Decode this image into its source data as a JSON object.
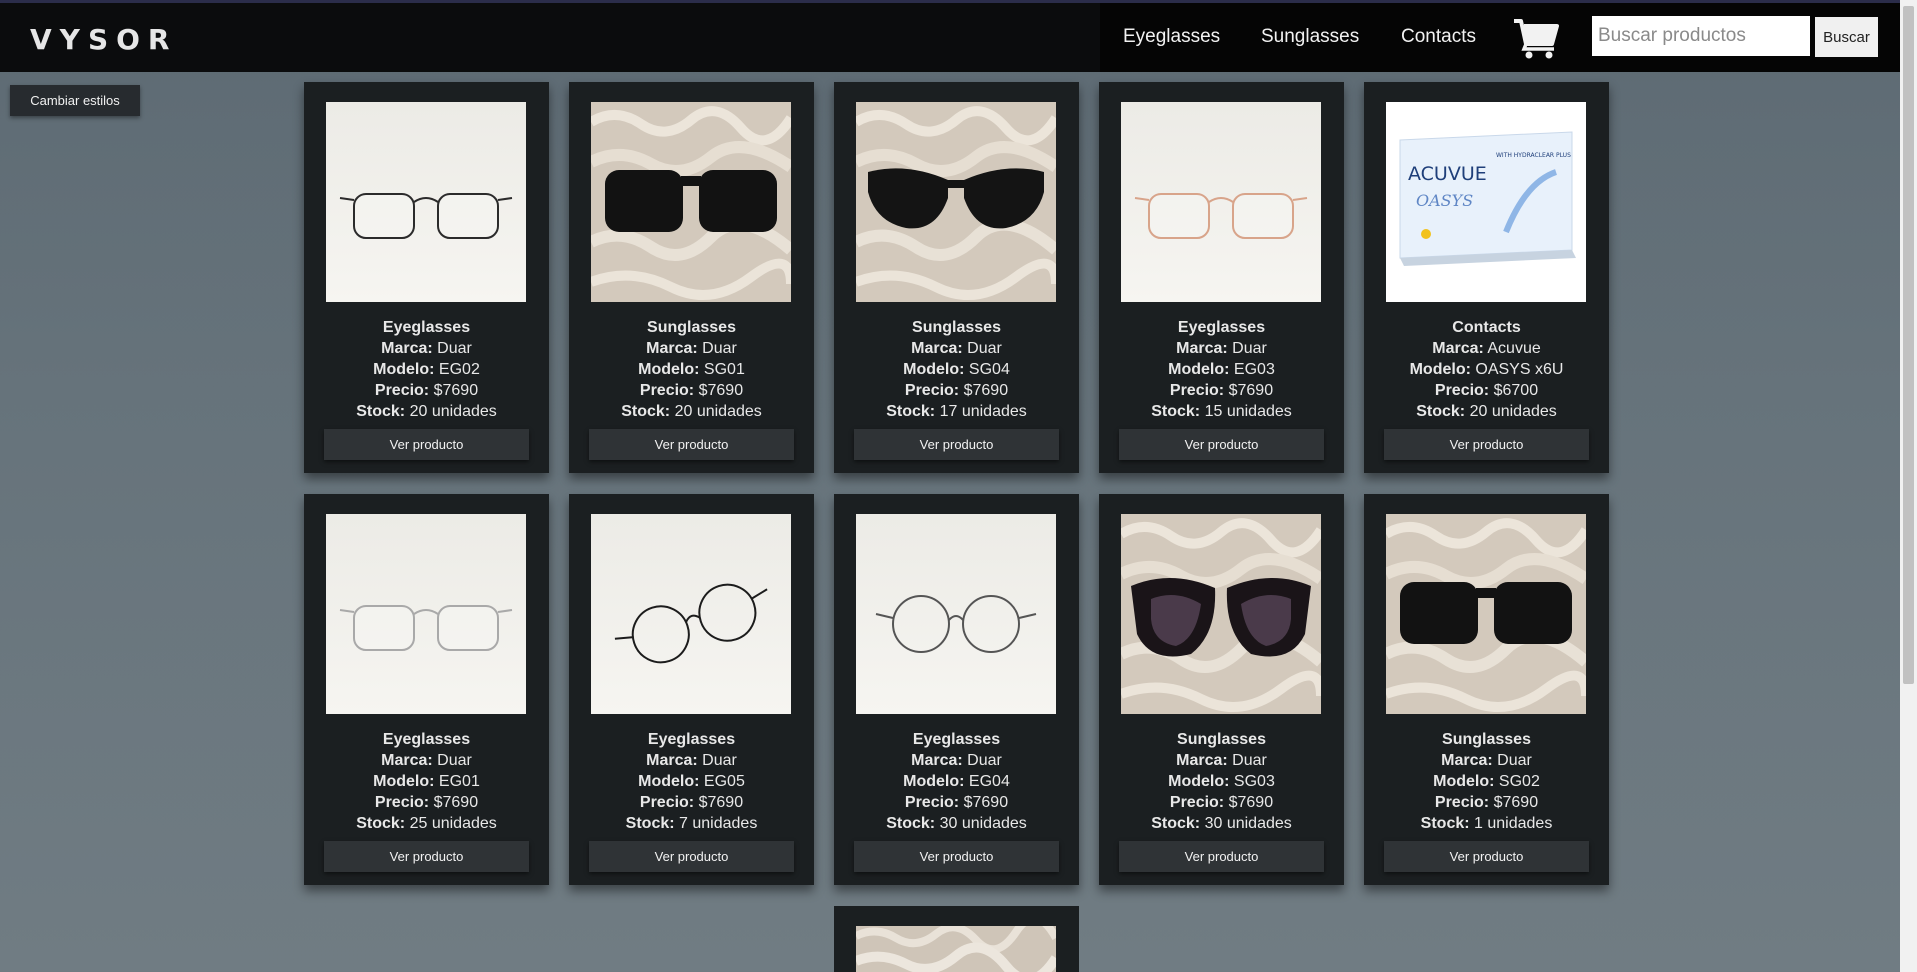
{
  "brand": "VYSOR",
  "nav": {
    "links": [
      "Eyeglasses",
      "Sunglasses",
      "Contacts"
    ]
  },
  "search": {
    "placeholder": "Buscar productos",
    "button": "Buscar"
  },
  "style_button": "Cambiar estilos",
  "labels": {
    "marca": "Marca:",
    "modelo": "Modelo:",
    "precio": "Precio:",
    "stock": "Stock:",
    "view": "Ver producto"
  },
  "products": [
    {
      "category": "Eyeglasses",
      "marca": "Duar",
      "modelo": "EG02",
      "precio": "$7690",
      "stock": "20 unidades",
      "image": "eyeglasses-gold"
    },
    {
      "category": "Sunglasses",
      "marca": "Duar",
      "modelo": "SG01",
      "precio": "$7690",
      "stock": "20 unidades",
      "image": "sunglasses-square-fur"
    },
    {
      "category": "Sunglasses",
      "marca": "Duar",
      "modelo": "SG04",
      "precio": "$7690",
      "stock": "17 unidades",
      "image": "sunglasses-cat-fur"
    },
    {
      "category": "Eyeglasses",
      "marca": "Duar",
      "modelo": "EG03",
      "precio": "$7690",
      "stock": "15 unidades",
      "image": "eyeglasses-rose"
    },
    {
      "category": "Contacts",
      "marca": "Acuvue",
      "modelo": "OASYS x6U",
      "precio": "$6700",
      "stock": "20 unidades",
      "image": "contacts-box"
    },
    {
      "category": "Eyeglasses",
      "marca": "Duar",
      "modelo": "EG01",
      "precio": "$7690",
      "stock": "25 unidades",
      "image": "eyeglasses-silver"
    },
    {
      "category": "Eyeglasses",
      "marca": "Duar",
      "modelo": "EG05",
      "precio": "$7690",
      "stock": "7 unidades",
      "image": "eyeglasses-black-angle"
    },
    {
      "category": "Eyeglasses",
      "marca": "Duar",
      "modelo": "EG04",
      "precio": "$7690",
      "stock": "30 unidades",
      "image": "eyeglasses-round"
    },
    {
      "category": "Sunglasses",
      "marca": "Duar",
      "modelo": "SG03",
      "precio": "$7690",
      "stock": "30 unidades",
      "image": "sunglasses-butterfly-fur"
    },
    {
      "category": "Sunglasses",
      "marca": "Duar",
      "modelo": "SG02",
      "precio": "$7690",
      "stock": "1 unidades",
      "image": "sunglasses-square-fur"
    }
  ],
  "box_text": {
    "brand": "ACUVUE",
    "line": "OASYS",
    "sub": "WITH HYDRACLEAR PLUS"
  },
  "colors": {
    "header": "#0b0c0d",
    "card": "#1b1f21",
    "button": "#2f3336",
    "background": "#66737b"
  }
}
